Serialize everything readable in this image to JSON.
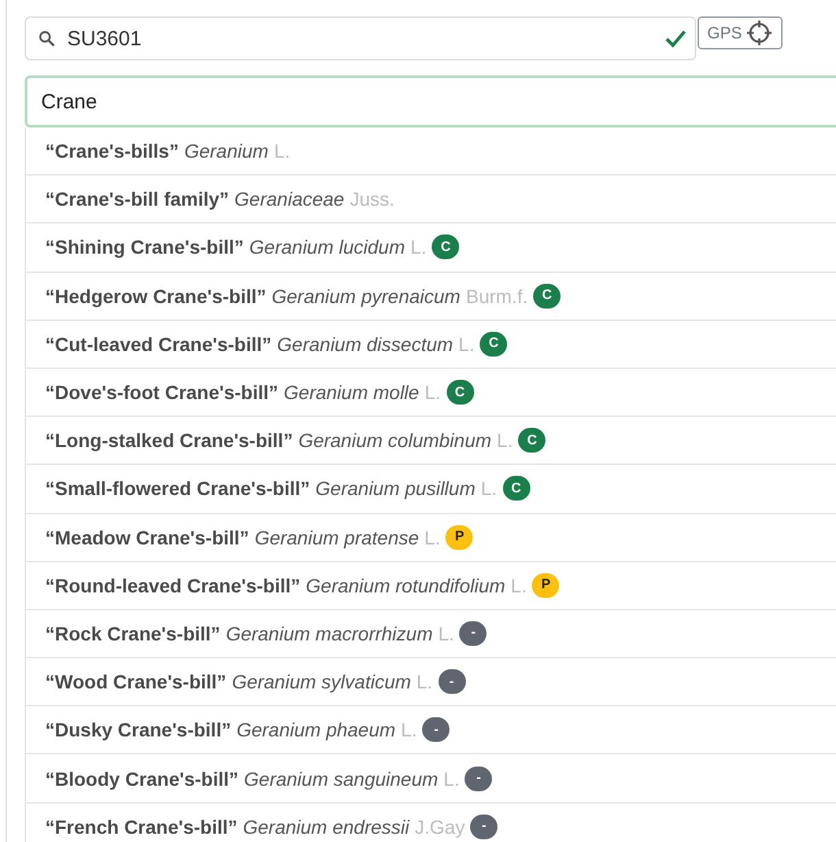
{
  "location_field": {
    "value": "SU3601",
    "valid": true
  },
  "gps_button": {
    "label": "GPS"
  },
  "taxon_field": {
    "value": "Crane"
  },
  "suggestions": [
    {
      "common": "“Crane's-bills”",
      "scientific": "Geranium",
      "author": "L."
    },
    {
      "common": "“Crane's-bill family”",
      "scientific": "Geraniaceae",
      "author": "Juss."
    },
    {
      "common": "“Shining Crane's-bill”",
      "scientific": "Geranium lucidum",
      "author": "L.",
      "badge": {
        "label": "C",
        "color": "#1a7f4b"
      }
    },
    {
      "common": "“Hedgerow Crane's-bill”",
      "scientific": "Geranium pyrenaicum",
      "author": "Burm.f.",
      "badge": {
        "label": "C",
        "color": "#1a7f4b"
      }
    },
    {
      "common": "“Cut-leaved Crane's-bill”",
      "scientific": "Geranium dissectum",
      "author": "L.",
      "badge": {
        "label": "C",
        "color": "#1a7f4b"
      }
    },
    {
      "common": "“Dove's-foot Crane's-bill”",
      "scientific": "Geranium molle",
      "author": "L.",
      "badge": {
        "label": "C",
        "color": "#1a7f4b"
      }
    },
    {
      "common": "“Long-stalked Crane's-bill”",
      "scientific": "Geranium columbinum",
      "author": "L.",
      "badge": {
        "label": "C",
        "color": "#1a7f4b"
      }
    },
    {
      "common": "“Small-flowered Crane's-bill”",
      "scientific": "Geranium pusillum",
      "author": "L.",
      "badge": {
        "label": "C",
        "color": "#1a7f4b"
      }
    },
    {
      "common": "“Meadow Crane's-bill”",
      "scientific": "Geranium pratense",
      "author": "L.",
      "badge": {
        "label": "P",
        "color": "#fcc010"
      }
    },
    {
      "common": "“Round-leaved Crane's-bill”",
      "scientific": "Geranium rotundifolium",
      "author": "L.",
      "badge": {
        "label": "P",
        "color": "#fcc010"
      }
    },
    {
      "common": "“Rock Crane's-bill”",
      "scientific": "Geranium macrorrhizum",
      "author": "L.",
      "badge": {
        "label": "-",
        "color": "#5f6670"
      }
    },
    {
      "common": "“Wood Crane's-bill”",
      "scientific": "Geranium sylvaticum",
      "author": "L.",
      "badge": {
        "label": "-",
        "color": "#5f6670"
      }
    },
    {
      "common": "“Dusky Crane's-bill”",
      "scientific": "Geranium phaeum",
      "author": "L.",
      "badge": {
        "label": "-",
        "color": "#5f6670"
      }
    },
    {
      "common": "“Bloody Crane's-bill”",
      "scientific": "Geranium sanguineum",
      "author": "L.",
      "badge": {
        "label": "-",
        "color": "#5f6670"
      }
    },
    {
      "common": "“French Crane's-bill”",
      "scientific": "Geranium endressii",
      "author": "J.Gay",
      "badge": {
        "label": "-",
        "color": "#5f6670"
      }
    }
  ]
}
